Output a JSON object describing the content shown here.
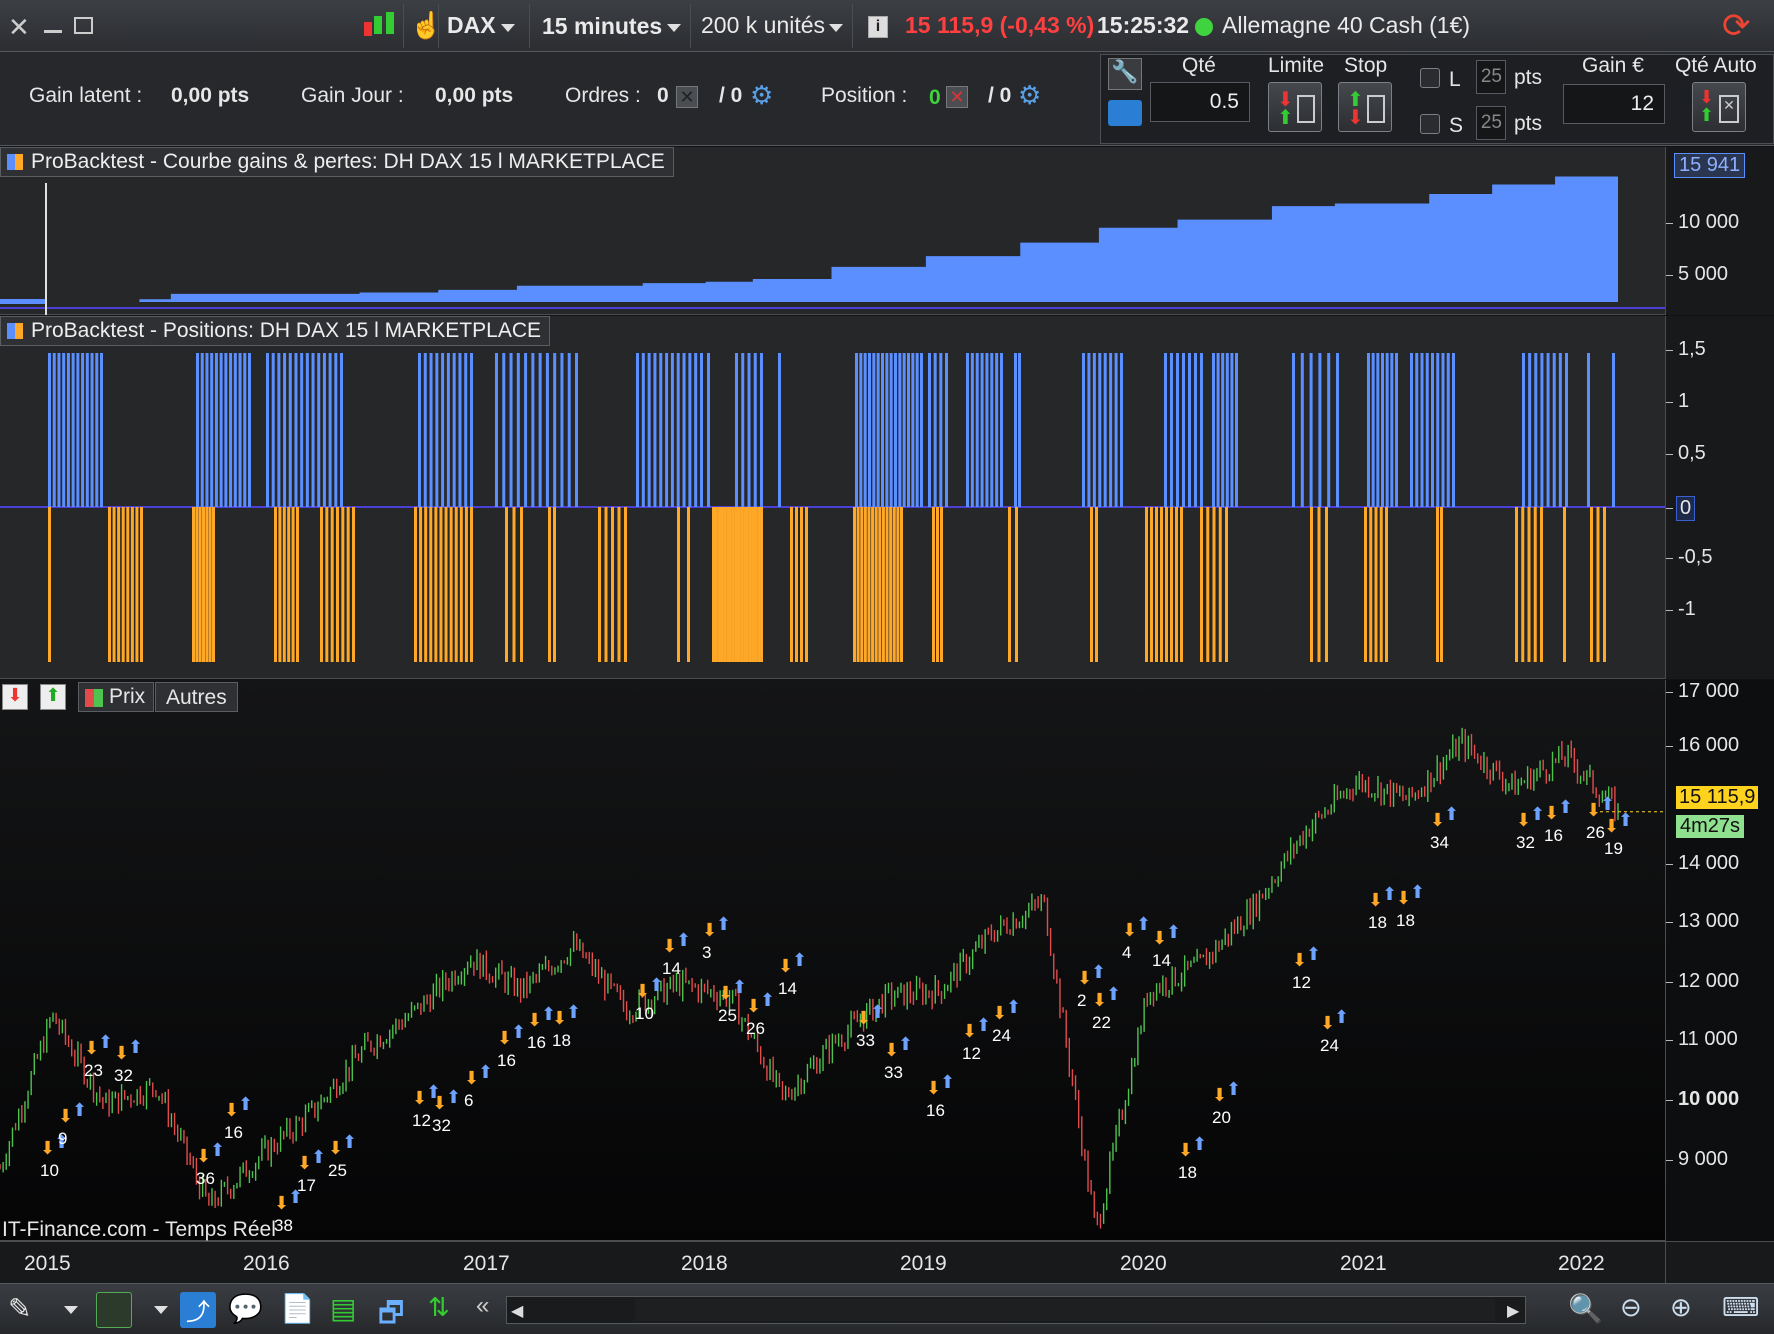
{
  "topbar": {
    "instrument": "DAX",
    "timeframe": "15 minutes",
    "units": "200 k unités",
    "price_change": "15 115,9 (-0,43 %)",
    "time": "15:25:32",
    "market_name": "Allemagne 40 Cash (1€)",
    "colors": {
      "negative": "#ff4040",
      "online": "#3fd43f"
    }
  },
  "orderbar": {
    "gain_latent_label": "Gain latent :",
    "gain_latent_value": "0,00 pts",
    "gain_jour_label": "Gain Jour :",
    "gain_jour_value": "0,00 pts",
    "ordres_label": "Ordres :",
    "ordres_count": "0",
    "ordres_pending": "/ 0",
    "position_label": "Position :",
    "position_count": "0",
    "position_pending": "/ 0",
    "qte_label": "Qté",
    "qte_value": "0.5",
    "limite_label": "Limite",
    "stop_label": "Stop",
    "l_label": "L",
    "s_label": "S",
    "l_pts": "25",
    "s_pts": "25",
    "pts_label": "pts",
    "gain_label": "Gain €",
    "gain_value": "12",
    "qte_auto_label": "Qté Auto"
  },
  "equity_panel": {
    "title": "ProBacktest - Courbe gains & pertes: DH DAX 15 l MARKETPLACE",
    "current_value": "15 941",
    "y_labels": [
      "10 000",
      "5 000"
    ],
    "color": "#5b8fff"
  },
  "positions_panel": {
    "title": "ProBacktest - Positions: DH DAX 15 l MARKETPLACE",
    "y_labels": [
      "1,5",
      "1",
      "0,5",
      "0",
      "-0,5",
      "-1"
    ],
    "long_color": "#5b8fff",
    "short_color": "#ffa726"
  },
  "price_panel": {
    "tab_prix": "Prix",
    "tab_autres": "Autres",
    "y_labels": [
      "17 000",
      "16 000",
      "14 000",
      "13 000",
      "12 000",
      "11 000",
      "10 000",
      "9 000"
    ],
    "last_price": "15 115,9",
    "countdown": "4m27s",
    "watermark": "IT-Finance.com - Temps Réel",
    "trade_labels": [
      "10",
      "9",
      "23",
      "32",
      "36",
      "16",
      "38",
      "17",
      "25",
      "12",
      "32",
      "6",
      "16",
      "16",
      "18",
      "10",
      "14",
      "3",
      "25",
      "26",
      "14",
      "33",
      "33",
      "16",
      "12",
      "24",
      "2",
      "22",
      "4",
      "14",
      "18",
      "20",
      "12",
      "24",
      "18",
      "18",
      "34",
      "32",
      "16",
      "26",
      "19"
    ]
  },
  "time_axis": {
    "labels": [
      "2015",
      "2016",
      "2017",
      "2018",
      "2019",
      "2020",
      "2021",
      "2022"
    ]
  },
  "chart_data": {
    "type": "line",
    "title": "",
    "x": [
      "2015-01",
      "2015-04",
      "2015-08",
      "2015-12",
      "2016-02",
      "2016-06",
      "2016-09",
      "2016-12",
      "2017-03",
      "2017-06",
      "2017-09",
      "2017-12",
      "2018-03",
      "2018-06",
      "2018-09",
      "2018-12",
      "2019-03",
      "2019-06",
      "2019-09",
      "2019-12",
      "2020-02",
      "2020-03",
      "2020-06",
      "2020-09",
      "2020-12",
      "2021-03",
      "2021-06",
      "2021-09",
      "2021-11",
      "2021-12",
      "2022-01",
      "2022-02"
    ],
    "series": [
      {
        "values": [
          9500,
          11900,
          10500,
          10800,
          8900,
          9700,
          10400,
          11400,
          12000,
          12800,
          12300,
          13000,
          12000,
          12400,
          12200,
          10600,
          11500,
          12200,
          12300,
          13200,
          13700,
          8500,
          12300,
          12700,
          13600,
          14800,
          15600,
          15300,
          16200,
          15500,
          16000,
          15115
        ]
      }
    ],
    "ylim": [
      8500,
      17000
    ],
    "xlabel": "",
    "ylabel": ""
  }
}
